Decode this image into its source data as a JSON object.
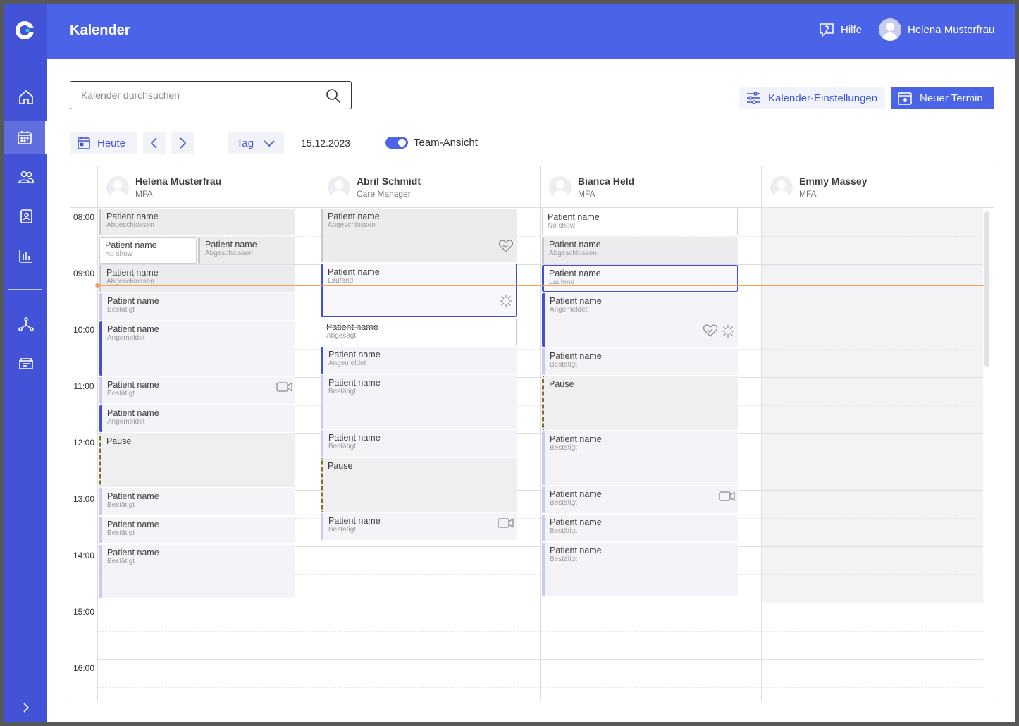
{
  "topbar": {
    "title": "Kalender",
    "help": "Hilfe",
    "user": "Helena Musterfrau"
  },
  "search": {
    "placeholder": "Kalender durchsuchen"
  },
  "actions": {
    "settings": "Kalender-Einstellungen",
    "new": "Neuer Termin"
  },
  "toolbar": {
    "today": "Heute",
    "view": "Tag",
    "date": "15.12.2023",
    "team_toggle": "Team-Ansicht",
    "team_on": true
  },
  "times": [
    "08:00",
    "09:00",
    "10:00",
    "11:00",
    "12:00",
    "13:00",
    "14:00",
    "15:00",
    "16:00"
  ],
  "staff": [
    {
      "name": "Helena Musterfrau",
      "role": "MFA"
    },
    {
      "name": "Abril Schmidt",
      "role": "Care Manager"
    },
    {
      "name": "Bianca Held",
      "role": "MFA"
    },
    {
      "name": "Emmy Massey",
      "role": "MFA"
    }
  ],
  "events": {
    "col0": [
      {
        "title": "Patient name",
        "status": "Abgeschlossen"
      },
      {
        "title": "Patient name",
        "status": "No show"
      },
      {
        "title": "Patient name",
        "status": "Abgeschlossen"
      },
      {
        "title": "Patient name",
        "status": "Abgeschlossen"
      },
      {
        "title": "Patient name",
        "status": "Bestätigt"
      },
      {
        "title": "Patient name",
        "status": "Angemeldet"
      },
      {
        "title": "Patient name",
        "status": "Bestätigt"
      },
      {
        "title": "Patient name",
        "status": "Angemeldet"
      },
      {
        "title": "Pause",
        "status": ""
      },
      {
        "title": "Patient name",
        "status": "Bestätigt"
      },
      {
        "title": "Patient name",
        "status": "Bestätigt"
      },
      {
        "title": "Patient name",
        "status": "Bestätigt"
      }
    ],
    "col1": [
      {
        "title": "Patient name",
        "status": "Abgeschlossen"
      },
      {
        "title": "Patient name",
        "status": "Laufend"
      },
      {
        "title": "Patient name",
        "status": "Abgesagt"
      },
      {
        "title": "Patient name",
        "status": "Angemeldet"
      },
      {
        "title": "Patient name",
        "status": "Bestätigt"
      },
      {
        "title": "Patient name",
        "status": "Bestätigt"
      },
      {
        "title": "Pause",
        "status": ""
      },
      {
        "title": "Patient name",
        "status": "Bestätigt"
      }
    ],
    "col2": [
      {
        "title": "Patient name",
        "status": "No show"
      },
      {
        "title": "Patient name",
        "status": "Abgeschlossen"
      },
      {
        "title": "Patient name",
        "status": "Laufend"
      },
      {
        "title": "Patient name",
        "status": "Angemeldet"
      },
      {
        "title": "Patient name",
        "status": "Bestätigt"
      },
      {
        "title": "Pause",
        "status": ""
      },
      {
        "title": "Patient name",
        "status": "Bestätigt"
      },
      {
        "title": "Patient name",
        "status": "Bestätigt"
      },
      {
        "title": "Patient name",
        "status": "Bestätigt"
      },
      {
        "title": "Patient name",
        "status": "Bestätigt"
      }
    ]
  },
  "colors": {
    "primary": "#4a63e7",
    "sidebar": "#4353d8",
    "now_line": "#f0a15a",
    "pause_border": "#8a6a2a"
  }
}
